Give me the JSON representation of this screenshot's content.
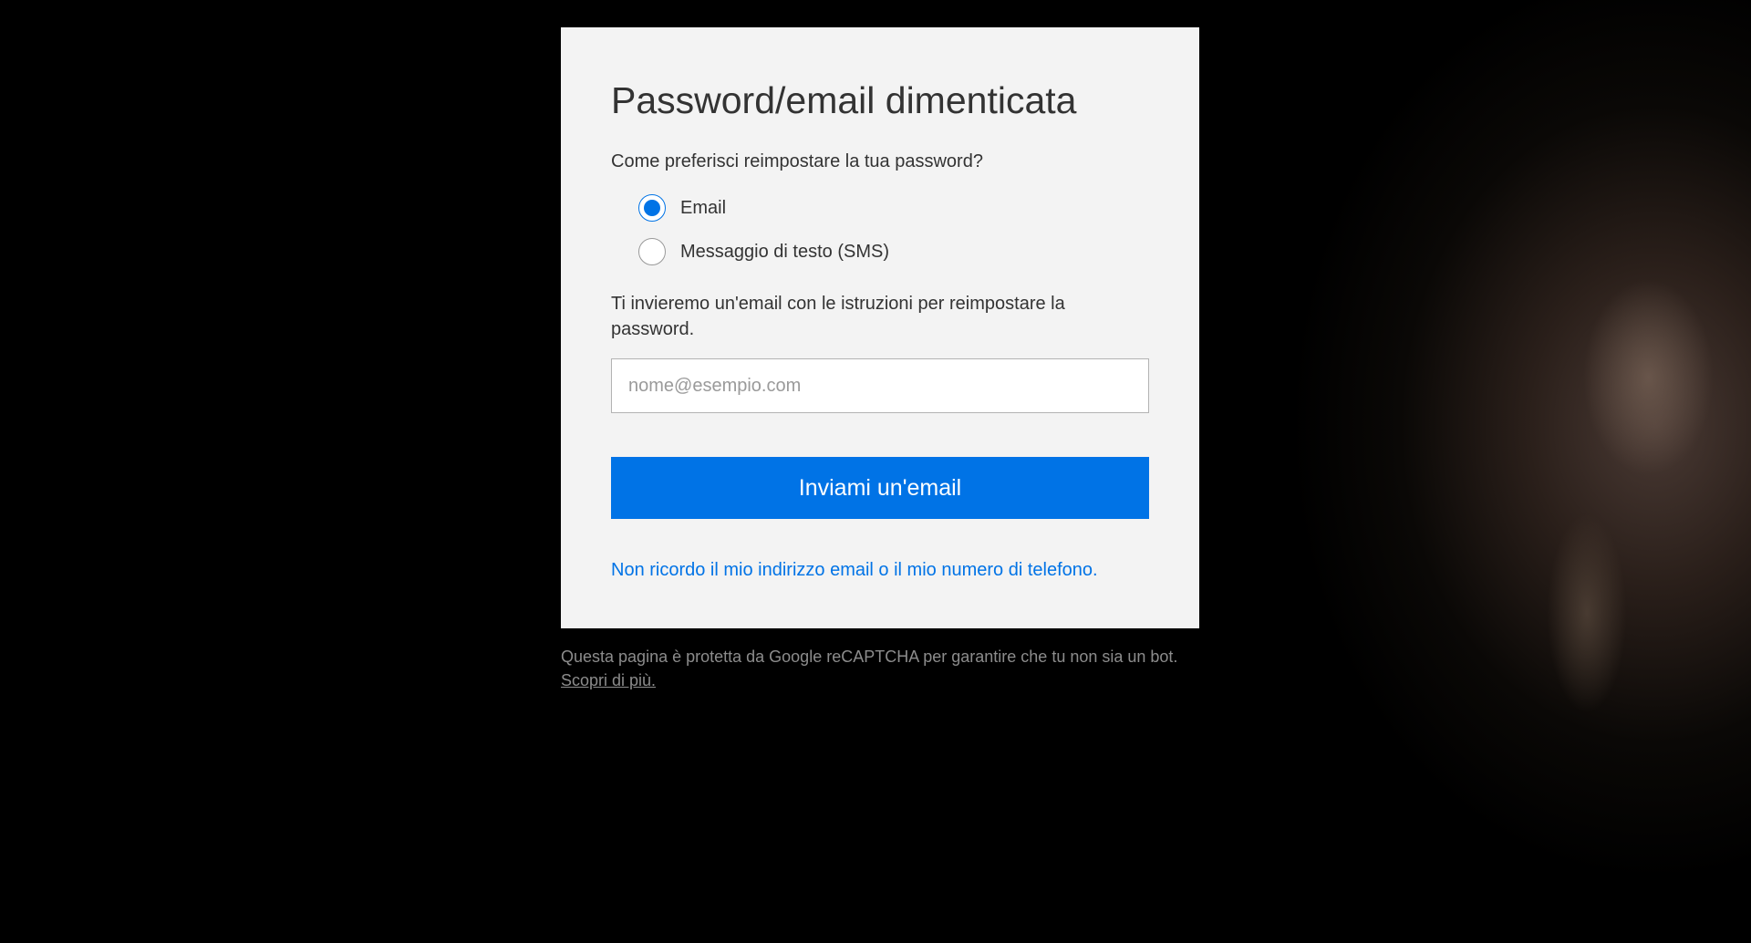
{
  "card": {
    "title": "Password/email dimenticata",
    "question": "Come preferisci reimpostare la tua password?",
    "options": {
      "email": "Email",
      "sms": "Messaggio di testo (SMS)"
    },
    "instruction": "Ti invieremo un'email con le istruzioni per reimpostare la password.",
    "email_placeholder": "nome@esempio.com",
    "submit_label": "Inviami un'email",
    "forgot_link": "Non ricordo il mio indirizzo email o il mio numero di telefono."
  },
  "recaptcha": {
    "notice_text": "Questa pagina è protetta da Google reCAPTCHA per garantire che tu non sia un bot. ",
    "link_text": "Scopri di più."
  }
}
